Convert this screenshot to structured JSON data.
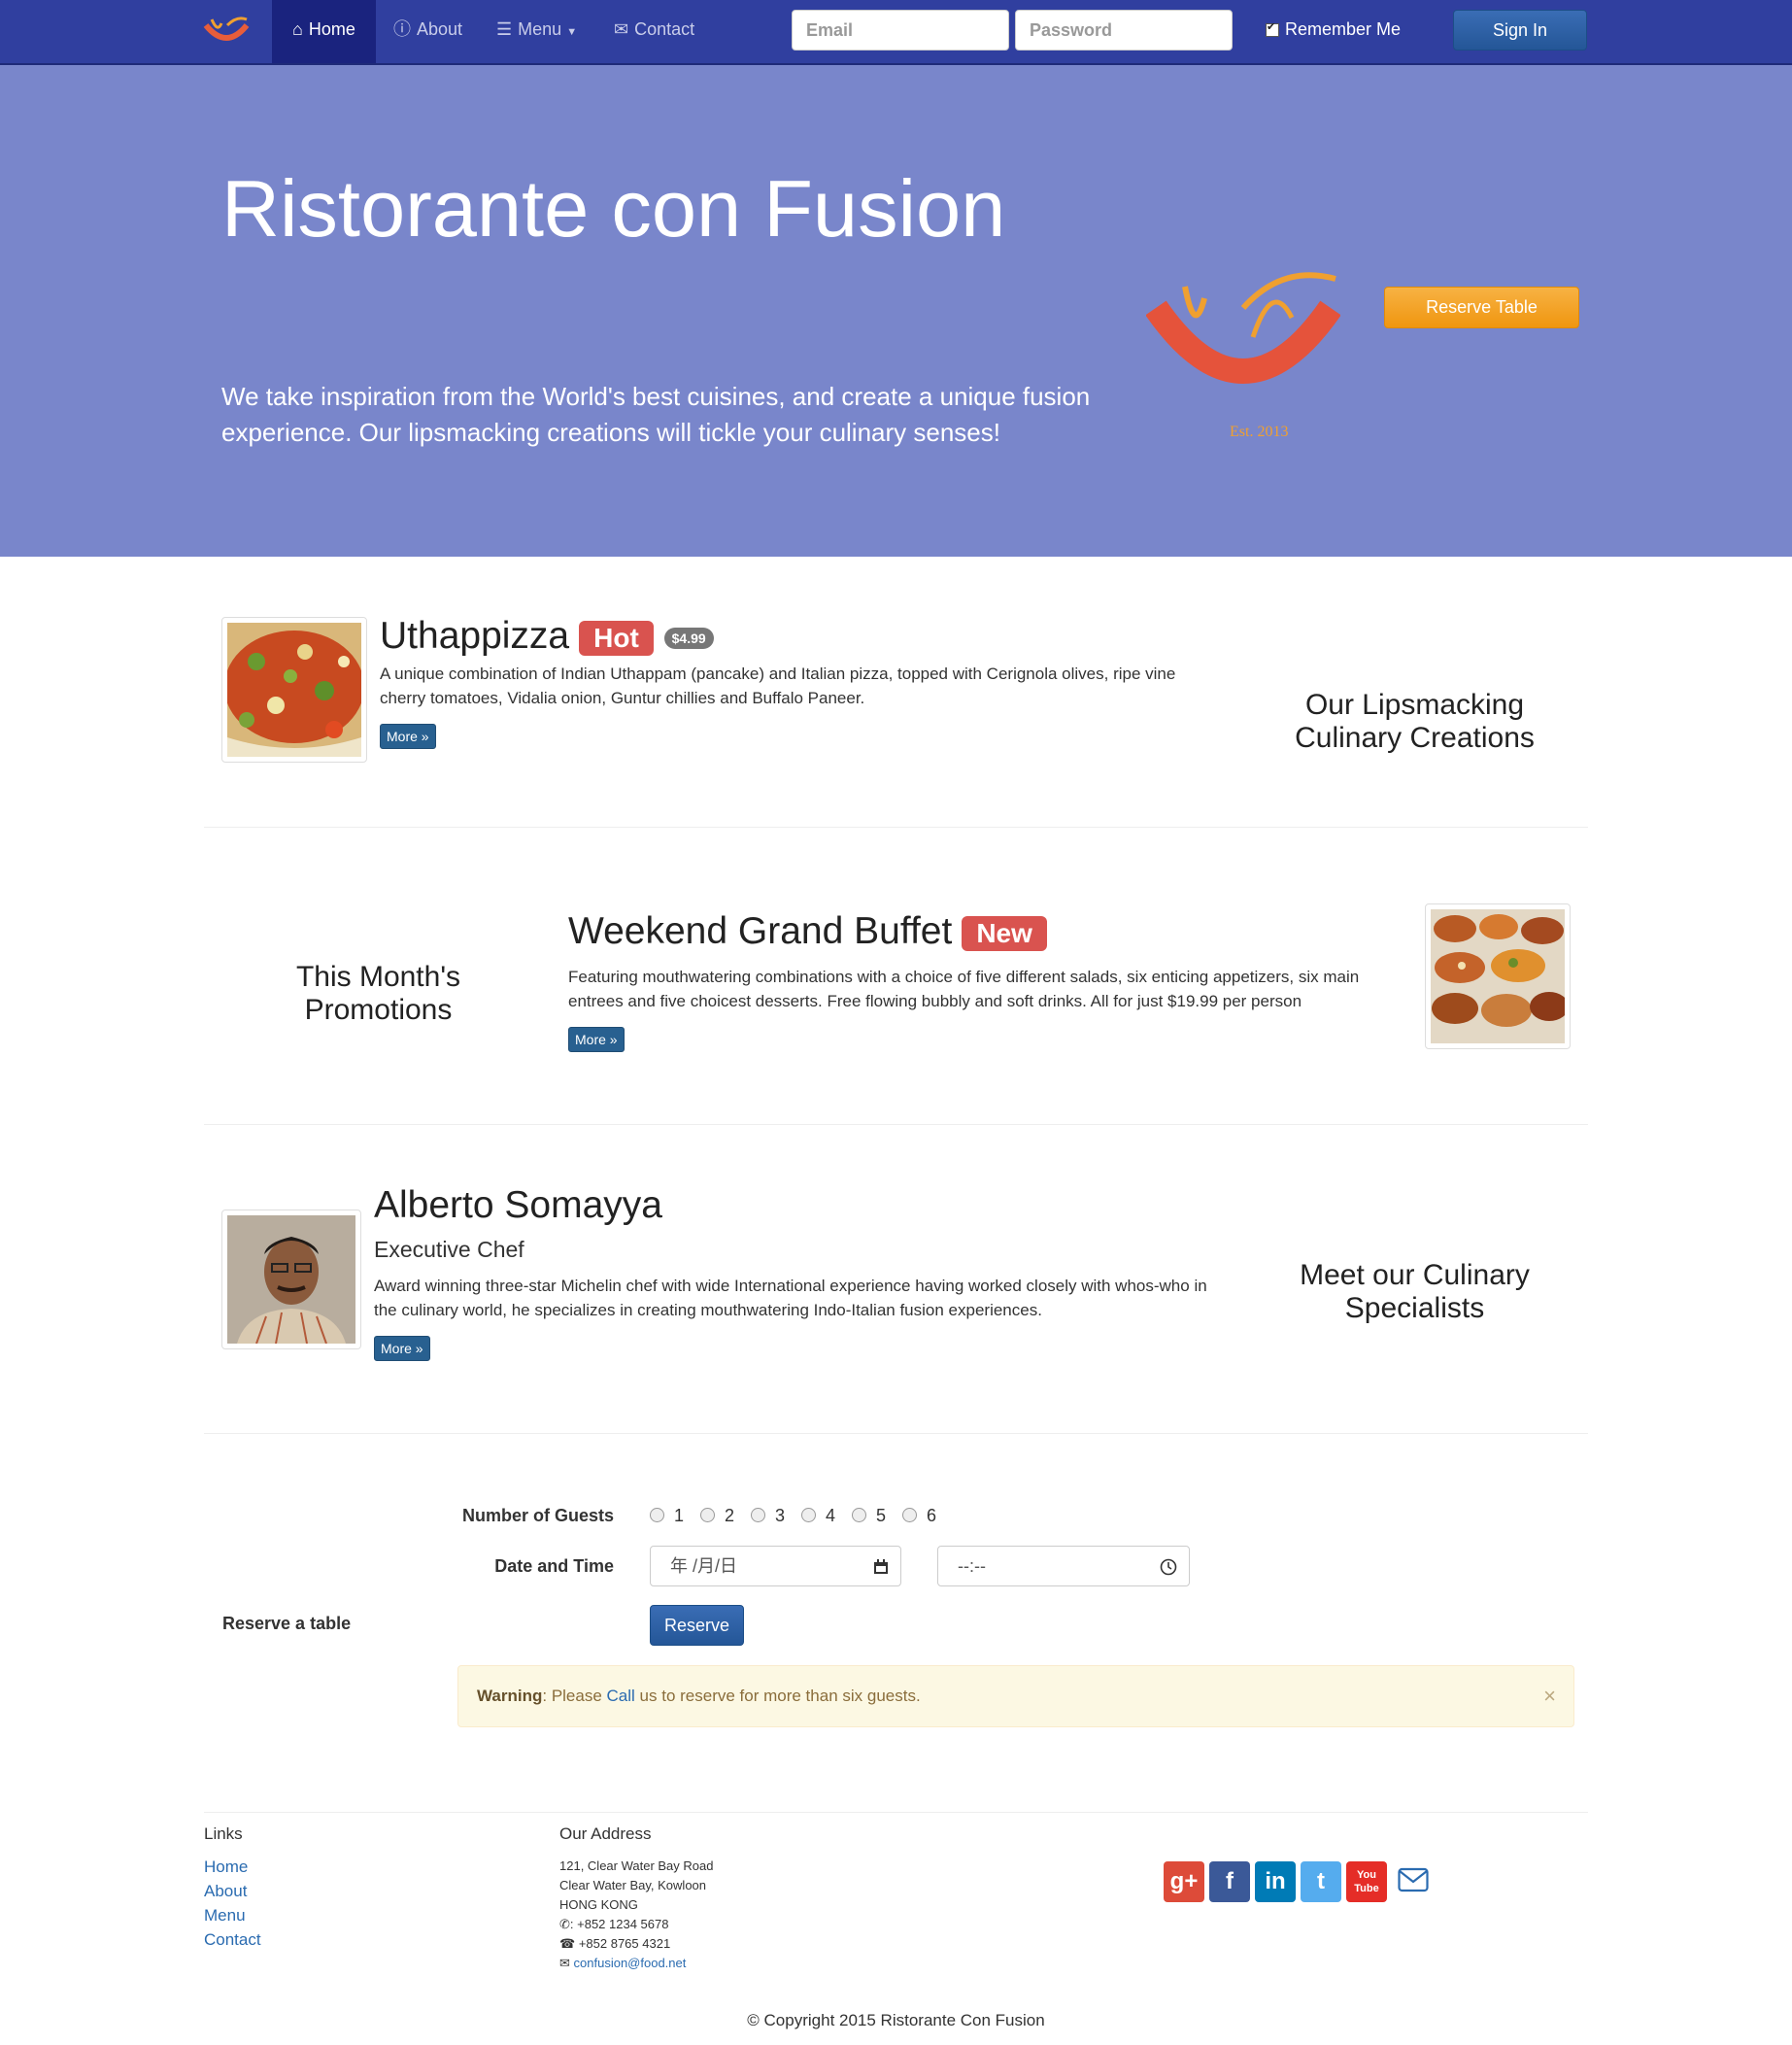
{
  "navbar": {
    "items": [
      {
        "label": "Home",
        "icon": "home-icon"
      },
      {
        "label": "About",
        "icon": "info-icon"
      },
      {
        "label": "Menu",
        "icon": "list-icon"
      },
      {
        "label": "Contact",
        "icon": "envelope-icon"
      }
    ],
    "email_placeholder": "Email",
    "password_placeholder": "Password",
    "remember_label": "Remember Me",
    "signin_label": "Sign In"
  },
  "hero": {
    "title": "Ristorante con Fusion",
    "description": "We take inspiration from the World's best cuisines, and create a unique fusion experience. Our lipsmacking creations will tickle your culinary senses!",
    "logo_text": "Ristorante con Fusion",
    "logo_est": "Est. 2013",
    "reserve_button": "Reserve Table",
    "background_color": "#7986cb"
  },
  "dish": {
    "title": "Uthappizza",
    "label": "Hot",
    "price": "$4.99",
    "description": "A unique combination of Indian Uthappam (pancake) and Italian pizza, topped with Cerignola olives, ripe vine cherry tomatoes, Vidalia onion, Guntur chillies and Buffalo Paneer.",
    "more": "More »",
    "side_heading": [
      "Our Lipsmacking",
      "Culinary Creations"
    ]
  },
  "promotion": {
    "title": "Weekend Grand Buffet",
    "label": "New",
    "description": "Featuring mouthwatering combinations with a choice of five different salads, six enticing appetizers, six main entrees and five choicest desserts. Free flowing bubbly and soft drinks. All for just $19.99 per person",
    "more": "More »",
    "side_heading": [
      "This Month's",
      "Promotions"
    ]
  },
  "chef": {
    "name": "Alberto Somayya",
    "role": "Executive Chef",
    "description": "Award winning three-star Michelin chef with wide International experience having worked closely with whos-who in the culinary world, he specializes in creating mouthwatering Indo-Italian fusion experiences.",
    "more": "More »",
    "side_heading": [
      "Meet our Culinary",
      "Specialists"
    ]
  },
  "reservation": {
    "section_label": "Reserve a table",
    "guests_label": "Number of Guests",
    "guest_options": [
      "1",
      "2",
      "3",
      "4",
      "5",
      "6"
    ],
    "datetime_label": "Date and Time",
    "date_placeholder": "年 /月/日",
    "time_placeholder": "--:--",
    "reserve_button": "Reserve",
    "warning_strong": "Warning",
    "warning_pre": ": Please ",
    "warning_link": "Call",
    "warning_post": " us to reserve for more than six guests.",
    "close": "×"
  },
  "footer": {
    "links_heading": "Links",
    "links": [
      "Home",
      "About",
      "Menu",
      "Contact"
    ],
    "address_heading": "Our Address",
    "address_lines": [
      "121, Clear Water Bay Road",
      "Clear Water Bay, Kowloon",
      "HONG KONG"
    ],
    "phone": ": +852 1234 5678",
    "fax": "+852 8765 4321",
    "email": "confusion@food.net",
    "social": [
      {
        "icon": "google-plus-icon",
        "glyph": "g+",
        "color": "#dd4b39"
      },
      {
        "icon": "facebook-icon",
        "glyph": "f",
        "color": "#3b5998"
      },
      {
        "icon": "linkedin-icon",
        "glyph": "in",
        "color": "#007bb6"
      },
      {
        "icon": "twitter-icon",
        "glyph": "t",
        "color": "#55acee"
      },
      {
        "icon": "youtube-icon",
        "glyph": "You Tube",
        "color": "#e52d27"
      }
    ],
    "copyright": "© Copyright 2015 Ristorante Con Fusion"
  }
}
